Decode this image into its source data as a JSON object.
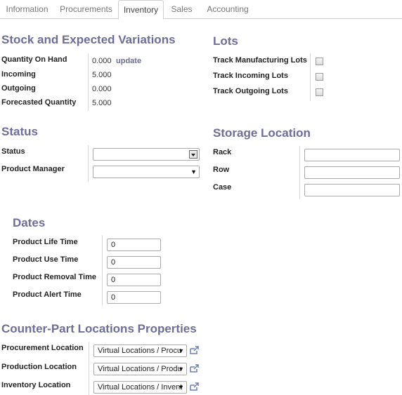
{
  "tabs": [
    "Information",
    "Procurements",
    "Inventory",
    "Sales",
    "Accounting"
  ],
  "active_tab": "Inventory",
  "stock": {
    "title": "Stock and Expected Variations",
    "qty_on_hand_label": "Quantity On Hand",
    "qty_on_hand_value": "0.000",
    "update_link": "update",
    "incoming_label": "Incoming",
    "incoming_value": "5.000",
    "outgoing_label": "Outgoing",
    "outgoing_value": "0.000",
    "forecast_label": "Forecasted Quantity",
    "forecast_value": "5.000"
  },
  "lots": {
    "title": "Lots",
    "manufacturing_label": "Track Manufacturing Lots",
    "incoming_label": "Track Incoming Lots",
    "outgoing_label": "Track Outgoing Lots"
  },
  "status": {
    "title": "Status",
    "status_label": "Status",
    "status_value": "",
    "manager_label": "Product Manager",
    "manager_value": ""
  },
  "storage": {
    "title": "Storage Location",
    "rack_label": "Rack",
    "rack_value": "",
    "row_label": "Row",
    "row_value": "",
    "case_label": "Case",
    "case_value": ""
  },
  "dates": {
    "title": "Dates",
    "life_label": "Product Life Time",
    "life_value": "0",
    "use_label": "Product Use Time",
    "use_value": "0",
    "removal_label": "Product Removal Time",
    "removal_value": "0",
    "alert_label": "Product Alert Time",
    "alert_value": "0"
  },
  "counterpart": {
    "title": "Counter-Part Locations Properties",
    "procurement_label": "Procurement Location",
    "procurement_value": "Virtual Locations / Procu",
    "production_label": "Production Location",
    "production_value": "Virtual Locations / Produ",
    "inventory_label": "Inventory Location",
    "inventory_value": "Virtual Locations / Invent"
  },
  "icons": {
    "external_link": "external-link-icon",
    "dropdown": "chevron-down-icon"
  },
  "colors": {
    "heading": "#6d6d9b",
    "link": "#6d6d9b",
    "border": "#cfcfcf"
  }
}
